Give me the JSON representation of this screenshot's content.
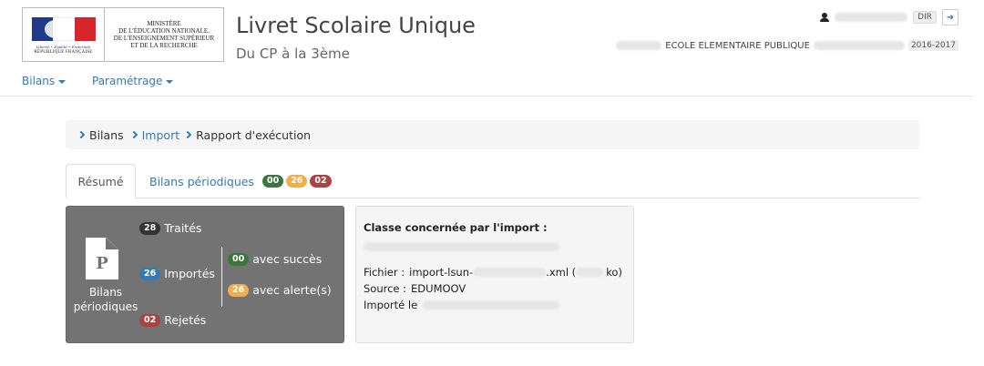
{
  "header": {
    "logo_devise": "Liberté • Égalité • Fraternité",
    "logo_republique": "RÉPUBLIQUE FRANÇAISE",
    "ministry_lines": [
      "MINISTÈRE",
      "DE L'ÉDUCATION NATIONALE,",
      "DE L'ENSEIGNEMENT SUPÉRIEUR",
      "ET DE LA RECHERCHE"
    ],
    "app_title": "Livret Scolaire Unique",
    "app_subtitle": "Du CP à la 3ème",
    "user_role": "DIR",
    "school_name": "ECOLE ELEMENTAIRE PUBLIQUE",
    "school_year": "2016-2017",
    "icons": {
      "user": "user-icon",
      "logout": "logout-icon"
    }
  },
  "nav": {
    "items": [
      {
        "label": "Bilans"
      },
      {
        "label": "Paramétrage"
      }
    ]
  },
  "breadcrumb": {
    "items": [
      "Bilans",
      "Import",
      "Rapport d'exécution"
    ]
  },
  "tabs": {
    "active": "Résumé",
    "second": "Bilans périodiques",
    "badges": [
      "00",
      "26",
      "02"
    ]
  },
  "summary": {
    "doc_letter": "P",
    "doc_label": "Bilans périodiques",
    "traites_count": "28",
    "traites_label": "Traités",
    "importes_count": "26",
    "importes_label": "Importés",
    "rejetes_count": "02",
    "rejetes_label": "Rejetés",
    "succes_count": "00",
    "succes_label": "avec succès",
    "alerte_count": "26",
    "alerte_label": "avec alerte(s)"
  },
  "info": {
    "title": "Classe concernée par l'import :",
    "fichier_label": "Fichier :",
    "fichier_prefix": "import-lsun-",
    "fichier_suffix": ".xml (",
    "fichier_unit": "ko)",
    "source_label": "Source :",
    "source_value": "EDUMOOV",
    "importe_label": "Importé le"
  },
  "colors": {
    "link": "#337ab7",
    "success": "#3c763d",
    "warning": "#f0ad4e",
    "danger": "#a94442",
    "panel_dark": "#737373"
  }
}
